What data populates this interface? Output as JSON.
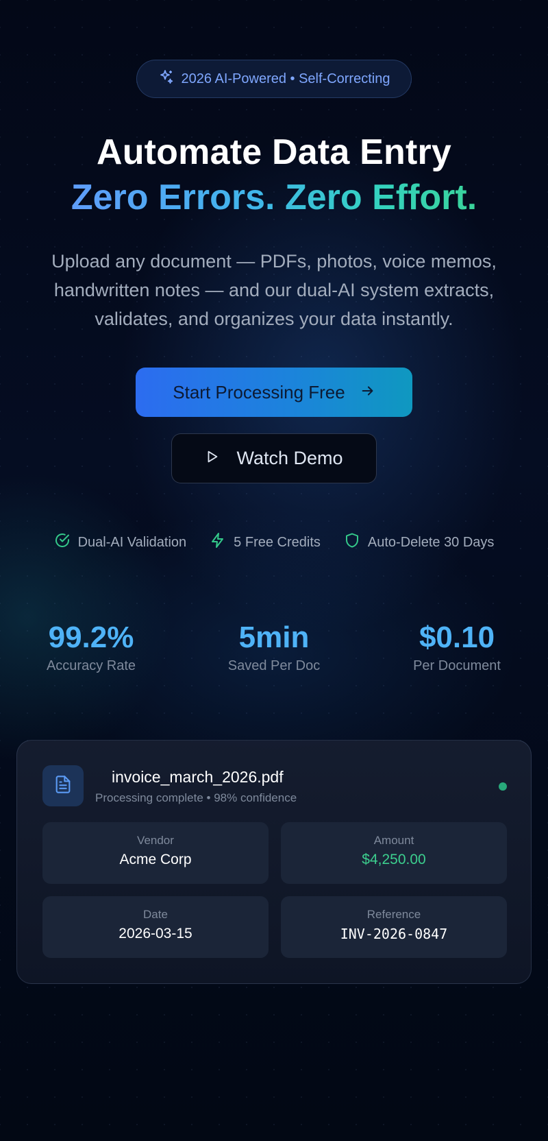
{
  "badge": {
    "icon": "sparkles-icon",
    "text": "2026 AI-Powered • Self-Correcting"
  },
  "hero": {
    "title_line1": "Automate Data Entry",
    "title_line2": "Zero Errors. Zero Effort.",
    "description": "Upload any document — PDFs, photos, voice memos, handwritten notes — and our dual-AI system extracts, validates, and organizes your data instantly."
  },
  "cta": {
    "primary_label": "Start Processing Free",
    "primary_icon": "arrow-right-icon",
    "secondary_label": "Watch Demo",
    "secondary_icon": "play-icon"
  },
  "features": [
    {
      "icon": "check-circle-icon",
      "label": "Dual-AI Validation"
    },
    {
      "icon": "bolt-icon",
      "label": "5 Free Credits"
    },
    {
      "icon": "shield-icon",
      "label": "Auto-Delete 30 Days"
    }
  ],
  "stats": [
    {
      "value": "99.2%",
      "label": "Accuracy Rate"
    },
    {
      "value": "5min",
      "label": "Saved Per Doc"
    },
    {
      "value": "$0.10",
      "label": "Per Document"
    }
  ],
  "preview": {
    "file_icon": "document-icon",
    "filename": "invoice_march_2026.pdf",
    "status": "Processing complete • 98% confidence",
    "fields": [
      {
        "label": "Vendor",
        "value": "Acme Corp"
      },
      {
        "label": "Amount",
        "value": "$4,250.00"
      },
      {
        "label": "Date",
        "value": "2026-03-15"
      },
      {
        "label": "Reference",
        "value": "INV-2026-0847"
      }
    ]
  },
  "colors": {
    "accent_blue": "#4fb3f7",
    "gradient_start": "#5f9dfb",
    "gradient_end": "#3ad39a",
    "success_green": "#3ccf8e"
  }
}
